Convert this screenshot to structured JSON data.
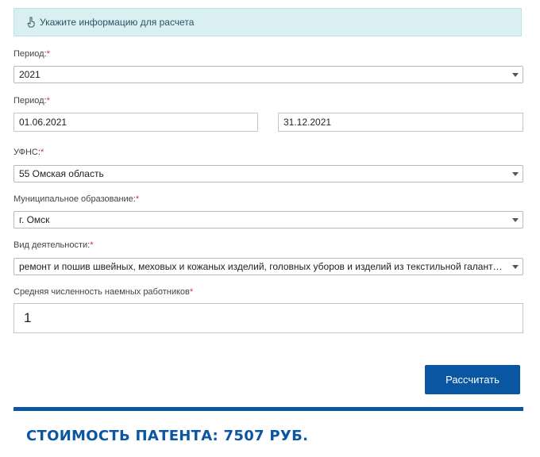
{
  "banner": {
    "icon": "pointing-hand-icon",
    "text": "Укажите информацию для расчета"
  },
  "form": {
    "required_mark": "*",
    "period_year": {
      "label": "Период:",
      "value": "2021"
    },
    "period_range": {
      "label": "Период:",
      "start": "01.06.2021",
      "end": "31.12.2021"
    },
    "ufns": {
      "label": "УФНС:",
      "value": "55 Омская область"
    },
    "municipality": {
      "label": "Муниципальное образование:",
      "value": "г. Омск"
    },
    "activity": {
      "label": "Вид деятельности:",
      "value": "ремонт и пошив швейных, меховых и кожаных изделий, головных уборов и изделий из текстильной галантереи, ремонт, пошив и вязание трикотажных изделий"
    },
    "employees": {
      "label": "Средняя численность наемных работников",
      "value": "1"
    }
  },
  "actions": {
    "calculate_label": "Рассчитать"
  },
  "result": {
    "text": "СТОИМОСТЬ ПАТЕНТА: 7507 РУБ."
  },
  "colors": {
    "accent": "#0b56a3",
    "banner_bg": "#d9eff2",
    "required": "#d0342c"
  }
}
